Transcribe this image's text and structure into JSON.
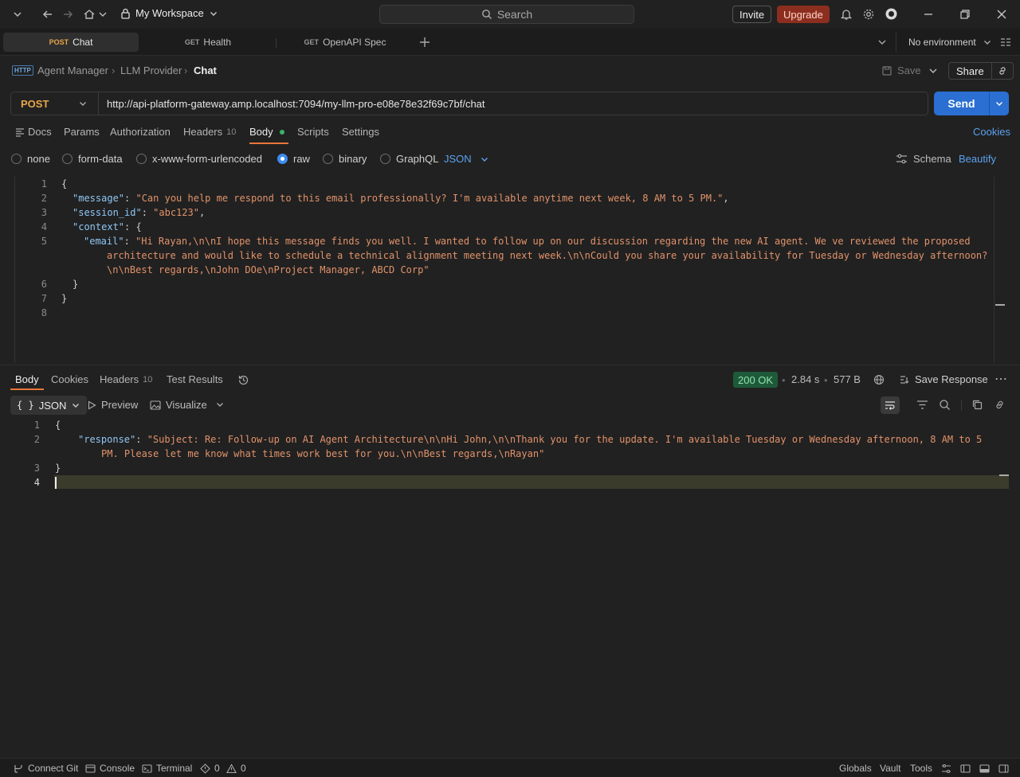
{
  "titlebar": {
    "workspace": "My Workspace",
    "search": "Search",
    "invite": "Invite",
    "upgrade": "Upgrade"
  },
  "tabs": [
    {
      "method": "POST",
      "name": "Chat"
    },
    {
      "method": "GET",
      "name": "Health"
    },
    {
      "method": "GET",
      "name": "OpenAPI Spec"
    }
  ],
  "environment": "No environment",
  "breadcrumb": {
    "a": "Agent Manager",
    "b": "LLM Provider",
    "c": "Chat",
    "save": "Save",
    "share": "Share"
  },
  "request": {
    "method": "POST",
    "url": "http://api-platform-gateway.amp.localhost:7094/my-llm-pro-e08e78e32f69c7bf/chat",
    "send": "Send"
  },
  "reqtabs": {
    "docs": "Docs",
    "params": "Params",
    "auth": "Authorization",
    "headers": "Headers",
    "headers_count": "10",
    "body": "Body",
    "scripts": "Scripts",
    "settings": "Settings",
    "cookies": "Cookies"
  },
  "bodymodes": {
    "none": "none",
    "formdata": "form-data",
    "urlenc": "x-www-form-urlencoded",
    "raw": "raw",
    "binary": "binary",
    "graphql": "GraphQL",
    "format": "JSON",
    "schema": "Schema",
    "beautify": "Beautify"
  },
  "reqbody": {
    "k_message": "\"message\"",
    "v_message": "\"Can you help me respond to this email professionally? I'm available anytime next week, 8 AM to 5 PM.\"",
    "k_session": "\"session_id\"",
    "v_session": "\"abc123\"",
    "k_context": "\"context\"",
    "k_email": "\"email\"",
    "v_email_1": "\"Hi Rayan,\\n\\nI hope this message finds you well. I wanted to follow up on our discussion regarding the new AI agent. We ve reviewed the proposed",
    "v_email_2": "architecture and would like to schedule a technical alignment meeting next week.\\n\\nCould you share your availability for Tuesday or Wednesday afternoon?",
    "v_email_3": "\\n\\nBest regards,\\nJohn DOe\\nProject Manager, ABCD Corp\""
  },
  "response": {
    "tabs": {
      "body": "Body",
      "cookies": "Cookies",
      "headers": "Headers",
      "headers_count": "10",
      "tests": "Test Results"
    },
    "status": "200 OK",
    "time": "2.84 s",
    "size": "577 B",
    "save": "Save Response",
    "view": {
      "json": "JSON",
      "preview": "Preview",
      "visualize": "Visualize"
    },
    "k_response": "\"response\"",
    "v_response_1": "\"Subject: Re: Follow-up on AI Agent Architecture\\n\\nHi John,\\n\\nThank you for the update. I'm available Tuesday or Wednesday afternoon, 8 AM to 5",
    "v_response_2": "PM. Please let me know what times work best for you.\\n\\nBest regards,\\nRayan\""
  },
  "statusbar": {
    "git": "Connect Git",
    "console": "Console",
    "terminal": "Terminal",
    "errors": "0",
    "warnings": "0",
    "globals": "Globals",
    "vault": "Vault",
    "tools": "Tools"
  }
}
